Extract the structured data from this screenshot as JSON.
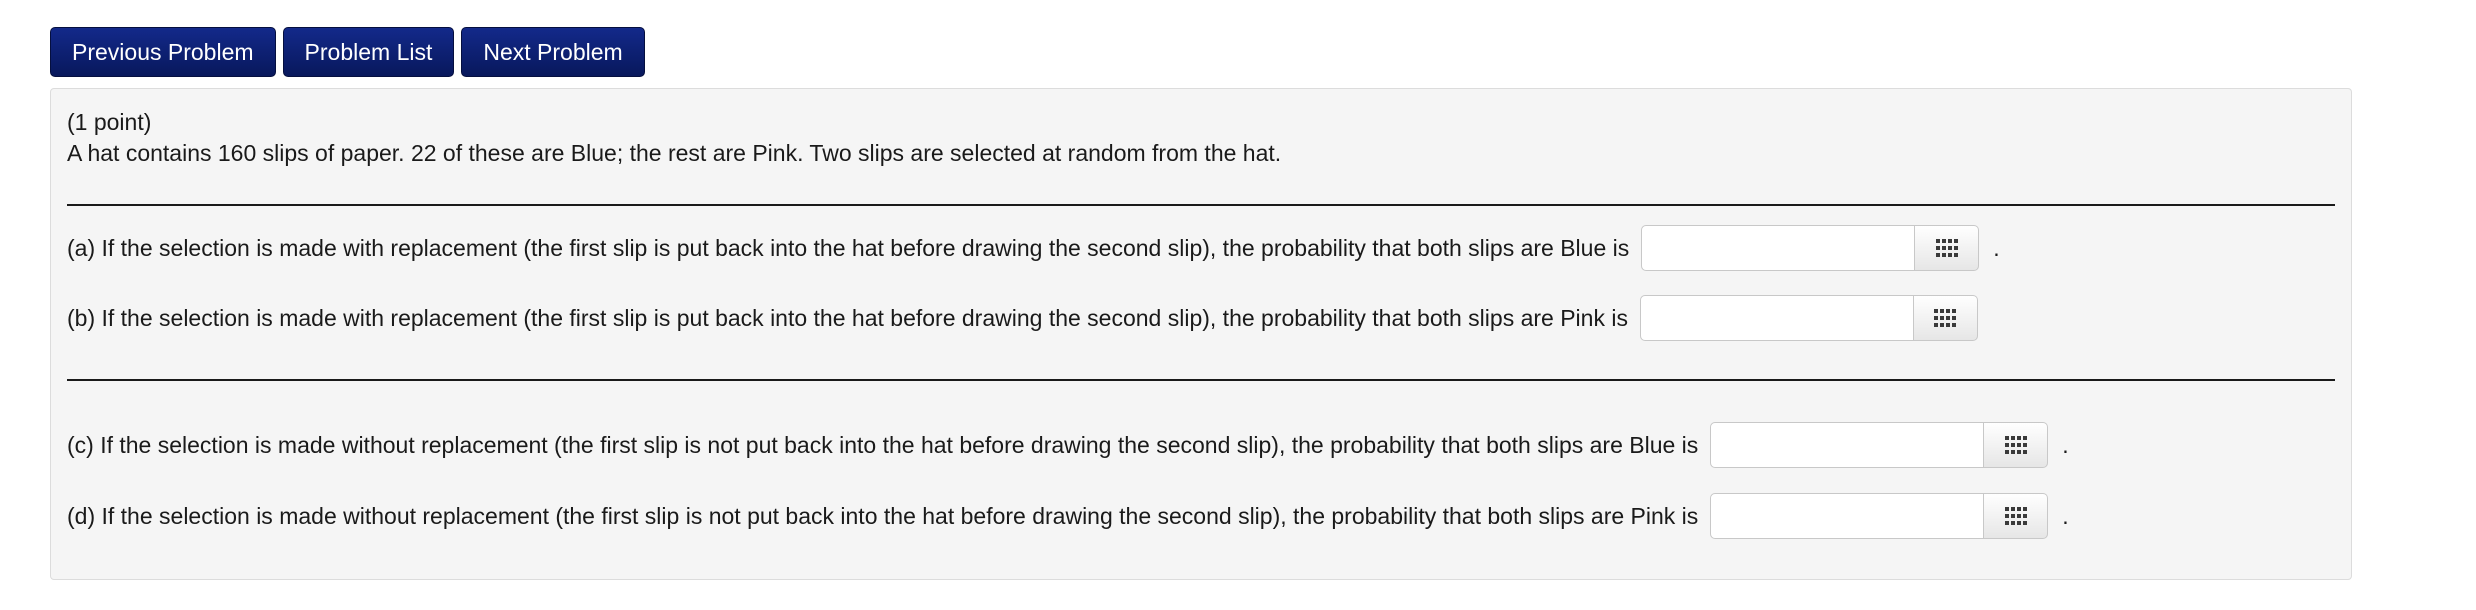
{
  "nav": {
    "previous_label": "Previous Problem",
    "list_label": "Problem List",
    "next_label": "Next Problem"
  },
  "problem": {
    "points": "(1 point)",
    "statement": "A hat contains 160 slips of paper. 22 of these are Blue; the rest are Pink. Two slips are selected at random from the hat.",
    "parts": [
      {
        "text": "(a) If the selection is made with replacement (the first slip is put back into the hat before drawing the second slip), the probability that both slips are Blue is",
        "value": "",
        "suffix": "."
      },
      {
        "text": "(b) If the selection is made with replacement (the first slip is put back into the hat before drawing the second slip), the probability that both slips are Pink is",
        "value": "",
        "suffix": ""
      },
      {
        "text": "(c) If the selection is made without replacement (the first slip is not put back into the hat before drawing the second slip), the probability that both slips are Blue is",
        "value": "",
        "suffix": "."
      },
      {
        "text": "(d) If the selection is made without replacement (the first slip is not put back into the hat before drawing the second slip), the probability that both slips are Pink is",
        "value": "",
        "suffix": "."
      }
    ]
  },
  "icons": {
    "palette": "keypad-grid-icon"
  },
  "colors": {
    "nav_button": "#0d2270",
    "panel_background": "#f5f5f5"
  }
}
